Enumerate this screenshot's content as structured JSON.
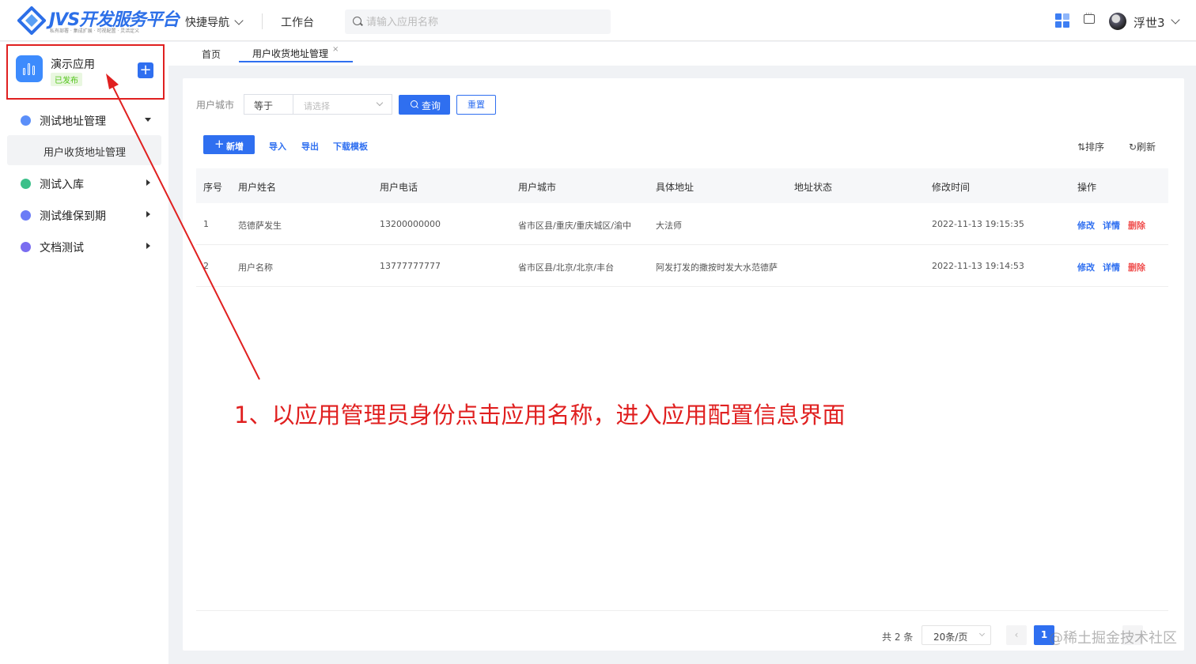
{
  "header": {
    "logo_title": "JVS开发服务平台",
    "logo_subtitle": "私有部署 · 集成扩展 · 可视配置 · 灵活定义",
    "nav_quick": "快捷导航",
    "nav_workbench": "工作台",
    "search_placeholder": "请输入应用名称",
    "username": "浮世3",
    "icons": [
      "apps-grid-icon",
      "message-icon",
      "avatar",
      "chevron-down-icon"
    ]
  },
  "sidebar": {
    "app": {
      "name": "演示应用",
      "status": "已发布",
      "add_symbol": "+"
    },
    "menu": [
      {
        "label": "测试地址管理",
        "expanded": true,
        "icon_color": "#5b8ff9"
      },
      {
        "label": "测试入库",
        "expanded": false,
        "icon_color": "#3cc08a"
      },
      {
        "label": "测试维保到期",
        "expanded": false,
        "icon_color": "#6b7cf6"
      },
      {
        "label": "文档测试",
        "expanded": false,
        "icon_color": "#7a6df0"
      }
    ],
    "submenu": [
      {
        "label": "用户收货地址管理",
        "active": true
      }
    ]
  },
  "tabs": [
    {
      "label": "首页",
      "active": false
    },
    {
      "label": "用户收货地址管理",
      "active": true,
      "close": "×"
    }
  ],
  "filter": {
    "label": "用户城市",
    "operator": "等于",
    "select_placeholder": "请选择",
    "query_label": "查询",
    "reset_label": "重置"
  },
  "toolbar": {
    "add_label": "新增",
    "add_symbol": "+",
    "import_label": "导入",
    "export_label": "导出",
    "template_label": "下载模板",
    "sort_label": "⇅排序",
    "refresh_label": "↻刷新"
  },
  "table": {
    "columns": [
      "序号",
      "用户姓名",
      "用户电话",
      "用户城市",
      "具体地址",
      "地址状态",
      "修改时间",
      "操作"
    ],
    "rows": [
      {
        "index": "1",
        "name": "范德萨发生",
        "phone": "13200000000",
        "city": "省市区县/重庆/重庆城区/渝中",
        "address": "大法师",
        "status": "",
        "modified": "2022-11-13 19:15:35"
      },
      {
        "index": "2",
        "name": "用户名称",
        "phone": "13777777777",
        "city": "省市区县/北京/北京/丰台",
        "address": "阿发打发的撒按时发大水范德萨",
        "status": "",
        "modified": "2022-11-13 19:14:53"
      }
    ],
    "actions": {
      "edit": "修改",
      "detail": "详情",
      "delete": "删除"
    }
  },
  "pagination": {
    "total": "共 2 条",
    "page_size": "20条/页",
    "prev": "‹",
    "current": "1",
    "next": "›"
  },
  "watermark": "@稀土掘金技术社区",
  "annotation": {
    "text": "1、以应用管理员身份点击应用名称，进入应用配置信息界面",
    "color": "#e02020"
  },
  "colors": {
    "primary": "#2f6ff0",
    "danger": "#f0504f",
    "success": "#52c41a"
  }
}
